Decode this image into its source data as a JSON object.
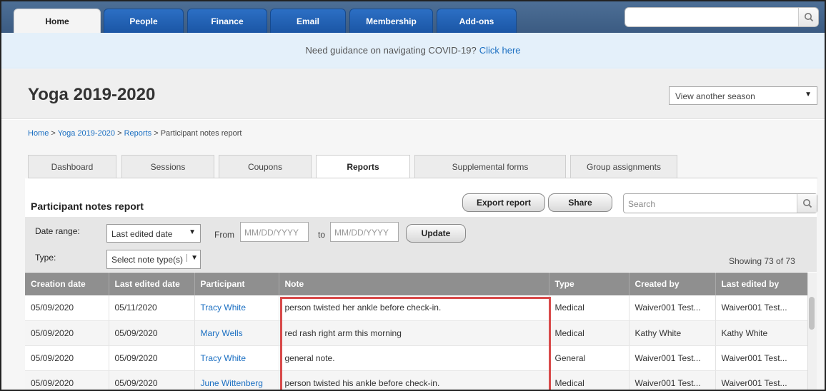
{
  "nav": {
    "tabs": [
      {
        "label": "Home",
        "active": true
      },
      {
        "label": "People",
        "active": false
      },
      {
        "label": "Finance",
        "active": false
      },
      {
        "label": "Email",
        "active": false
      },
      {
        "label": "Membership",
        "active": false
      },
      {
        "label": "Add-ons",
        "active": false
      }
    ],
    "search_icon": "search-icon"
  },
  "banner": {
    "text": "Need guidance on navigating COVID-19?",
    "link": "Click here"
  },
  "header": {
    "title": "Yoga 2019-2020",
    "season_select": "View another season"
  },
  "breadcrumb": {
    "items": [
      "Home",
      "Yoga 2019-2020",
      "Reports"
    ],
    "current": "Participant notes report",
    "separator": ">"
  },
  "subtabs": [
    {
      "label": "Dashboard",
      "active": false
    },
    {
      "label": "Sessions",
      "active": false
    },
    {
      "label": "Coupons",
      "active": false
    },
    {
      "label": "Reports",
      "active": true
    },
    {
      "label": "Supplemental forms",
      "active": false
    },
    {
      "label": "Group assignments",
      "active": false
    }
  ],
  "report": {
    "title": "Participant notes report",
    "export_label": "Export report",
    "share_label": "Share",
    "search_placeholder": "Search"
  },
  "filters": {
    "date_range_label": "Date range:",
    "date_range_value": "Last edited date",
    "from_label": "From",
    "from_placeholder": "MM/DD/YYYY",
    "to_label": "to",
    "to_placeholder": "MM/DD/YYYY",
    "update_label": "Update",
    "type_label": "Type:",
    "type_value": "Select note type(s)",
    "showing": "Showing 73 of 73"
  },
  "table": {
    "headers": [
      "Creation date",
      "Last edited date",
      "Participant",
      "Note",
      "Type",
      "Created by",
      "Last edited by"
    ],
    "rows": [
      [
        "05/09/2020",
        "05/11/2020",
        "Tracy White",
        "person twisted her ankle before check-in.",
        "Medical",
        "Waiver001 Test...",
        "Waiver001 Test..."
      ],
      [
        "05/09/2020",
        "05/09/2020",
        "Mary Wells",
        "red rash right arm this morning",
        "Medical",
        "Kathy White",
        "Kathy White"
      ],
      [
        "05/09/2020",
        "05/09/2020",
        "Tracy White",
        "general note.",
        "General",
        "Waiver001 Test...",
        "Waiver001 Test..."
      ],
      [
        "05/09/2020",
        "05/09/2020",
        "June Wittenberg",
        "person twisted his ankle before check-in.",
        "Medical",
        "Waiver001 Test...",
        "Waiver001 Test..."
      ]
    ]
  },
  "colors": {
    "nav_tab": "#1b56a5",
    "link": "#1b6fc2",
    "highlight": "#d84a4a",
    "table_header": "#8f8f8f"
  }
}
